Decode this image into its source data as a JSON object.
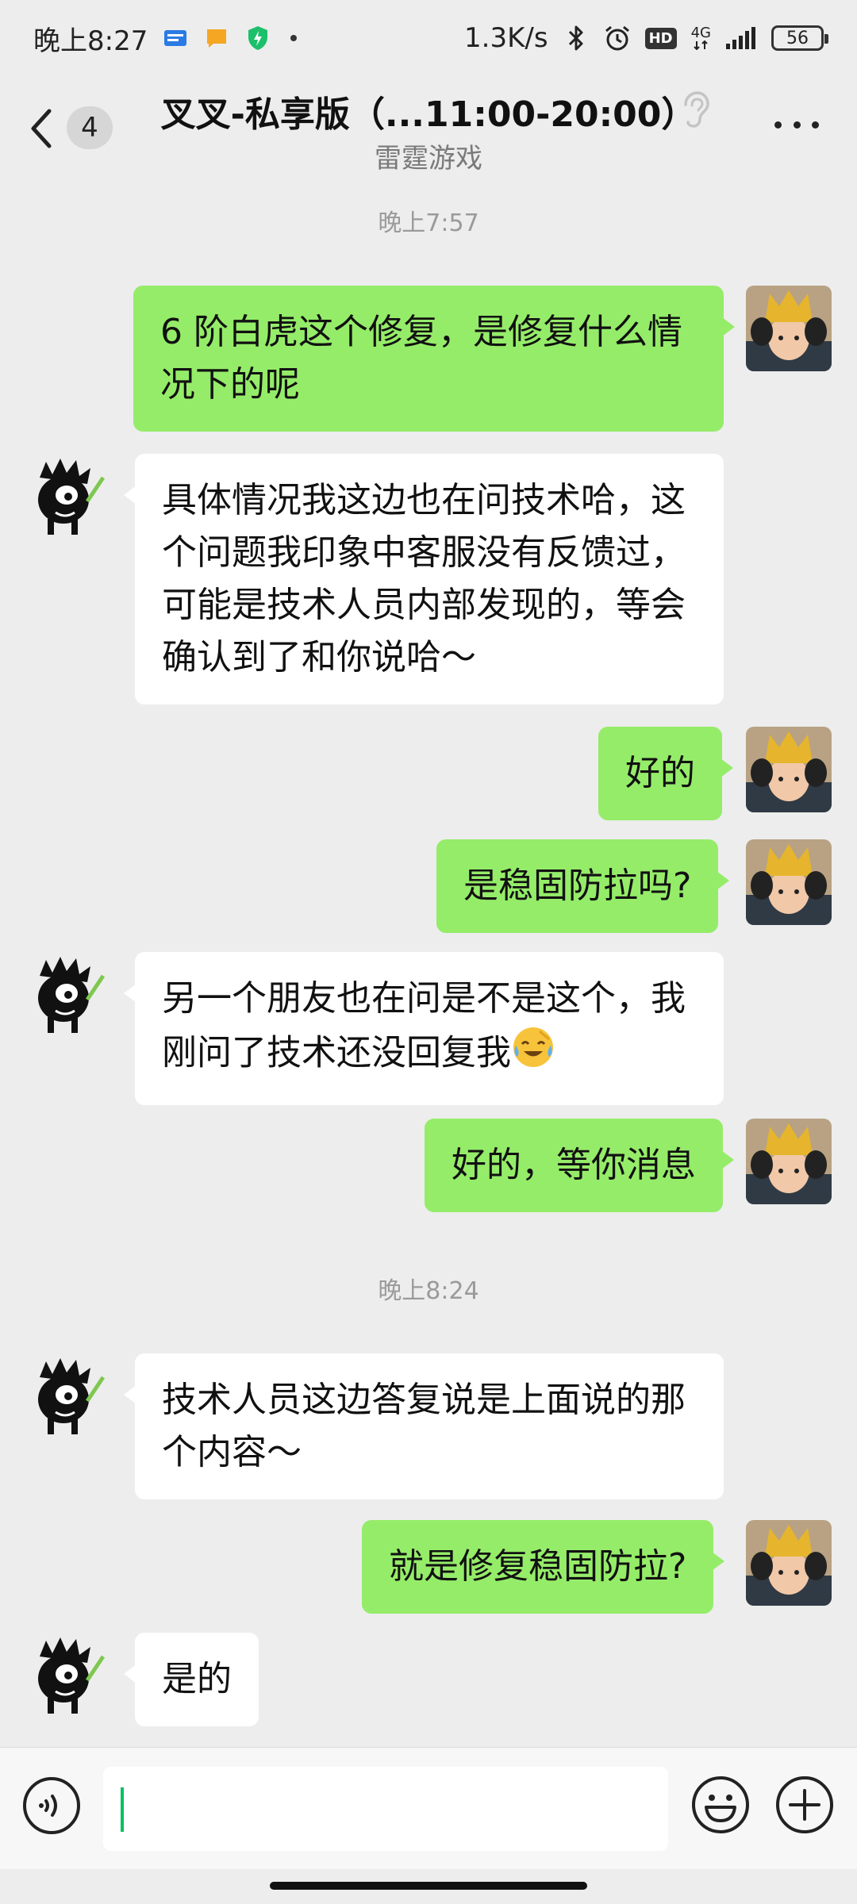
{
  "status_bar": {
    "time": "晚上8:27",
    "net_speed": "1.3K/s",
    "network_type": "4G",
    "hd_label": "HD",
    "battery": "56"
  },
  "header": {
    "back_label": "返回",
    "unread_count": "4",
    "title": "叉叉-私享版（...11:00-20:00）",
    "subtitle": "雷霆游戏",
    "icons": [
      "back-arrow-icon",
      "ear-icon",
      "more-icon"
    ]
  },
  "timestamps": [
    "晚上7:57",
    "晚上8:24"
  ],
  "messages": [
    {
      "side": "me",
      "text": "6 阶白虎这个修复，是修复什么情况下的呢"
    },
    {
      "side": "them",
      "text": "具体情况我这边也在问技术哈，这个问题我印象中客服没有反馈过，可能是技术人员内部发现的，等会确认到了和你说哈～"
    },
    {
      "side": "me",
      "text": "好的"
    },
    {
      "side": "me",
      "text": "是稳固防拉吗?"
    },
    {
      "side": "them",
      "text": "另一个朋友也在问是不是这个，我刚问了技术还没回复我",
      "emoji": "face-with-tears-of-joy"
    },
    {
      "side": "me",
      "text": "好的，等你消息"
    },
    {
      "side": "them",
      "text": "技术人员这边答复说是上面说的那个内容～"
    },
    {
      "side": "me",
      "text": "就是修复稳固防拉?"
    },
    {
      "side": "them",
      "text": "是的"
    }
  ],
  "input_bar": {
    "value": "",
    "icons": [
      "voice-icon",
      "emoji-icon",
      "plus-icon"
    ]
  },
  "colors": {
    "background": "#ededed",
    "my_bubble": "#95ec69",
    "their_bubble": "#ffffff",
    "cursor": "#07c160"
  }
}
